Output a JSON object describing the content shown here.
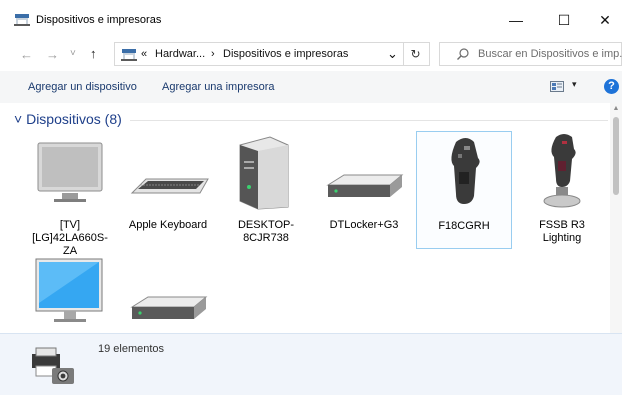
{
  "window": {
    "title": "Dispositivos e impresoras",
    "minimize_glyph": "—",
    "maximize_glyph": "☐",
    "close_glyph": "✕"
  },
  "address": {
    "back_glyph": "←",
    "forward_glyph": "→",
    "recent_glyph": "˅",
    "up_glyph": "↑",
    "overflow": "«",
    "crumb1": "Hardwar...",
    "separator": "›",
    "crumb2": "Dispositivos e impresoras",
    "dropdown_glyph": "⌄",
    "refresh_glyph": "↻",
    "search_placeholder": "Buscar en Dispositivos e imp..."
  },
  "commands": {
    "add_device": "Agregar un dispositivo",
    "add_printer": "Agregar una impresora",
    "view_dropdown_glyph": "▾",
    "help_glyph": "?"
  },
  "group": {
    "chevron": "˅",
    "label": "Dispositivos (8)"
  },
  "devices": [
    {
      "label": "[TV][LG]42LA660S-ZA",
      "icon": "tv-monitor-icon"
    },
    {
      "label": "Apple Keyboard",
      "icon": "keyboard-icon"
    },
    {
      "label": "DESKTOP-8CJR738",
      "icon": "desktop-tower-icon"
    },
    {
      "label": "DTLocker+G3",
      "icon": "external-drive-icon"
    },
    {
      "label": "F18CGRH",
      "icon": "joystick-icon"
    },
    {
      "label": "FSSB R3 Lighting",
      "icon": "joystick-base-icon"
    },
    {
      "label": "",
      "icon": "monitor-icon"
    },
    {
      "label": "",
      "icon": "external-drive-icon"
    }
  ],
  "status": {
    "count_text": "19 elementos",
    "icon": "devices-printers-icon"
  },
  "colors": {
    "link": "#1a3a6e",
    "group_header": "#1e3f8a",
    "help": "#1e73d8",
    "selection_border": "#99cdf0"
  }
}
